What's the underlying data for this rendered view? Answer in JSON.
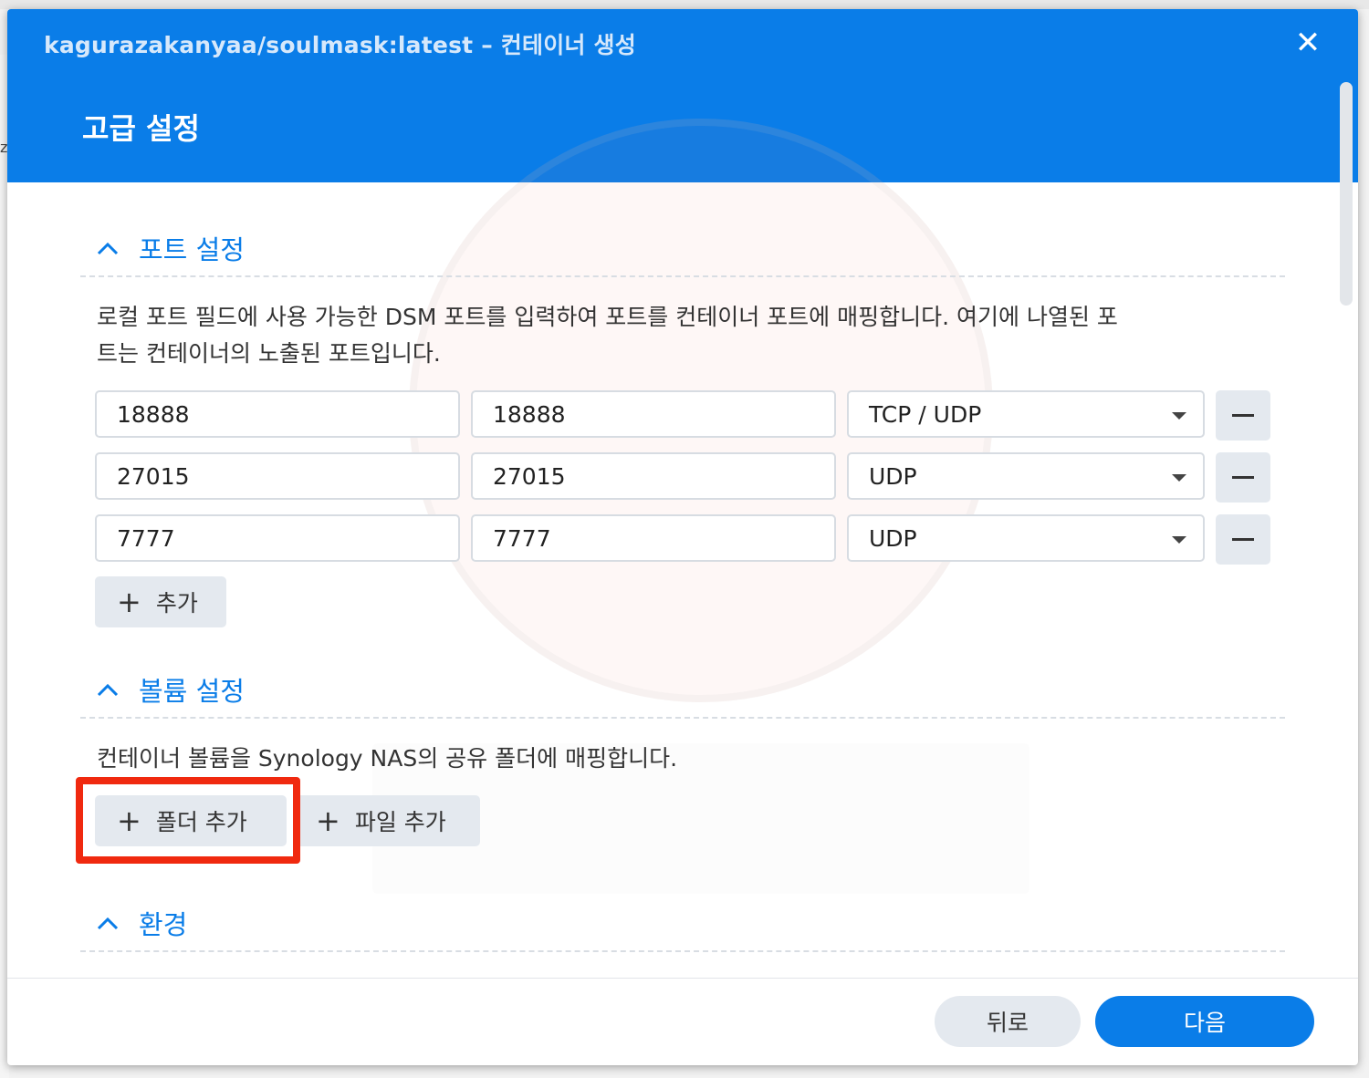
{
  "window": {
    "title": "kagurazakanyaa/soulmask:latest – 컨테이너 생성",
    "close_icon": "close-icon",
    "page_title": "고급 설정"
  },
  "background": {
    "left_char": "z"
  },
  "ports": {
    "header": "포트 설정",
    "description_line1": "로컬 포트 필드에 사용 가능한 DSM 포트를 입력하여 포트를 컨테이너 포트에 매핑합니다. 여기에 나열된 포",
    "description_line2": "트는 컨테이너의 노출된 포트입니다.",
    "rows": [
      {
        "local": "18888",
        "container": "18888",
        "protocol": "TCP / UDP"
      },
      {
        "local": "27015",
        "container": "27015",
        "protocol": "UDP"
      },
      {
        "local": "7777",
        "container": "7777",
        "protocol": "UDP"
      }
    ],
    "add_label": "추가"
  },
  "volumes": {
    "header": "볼륨 설정",
    "description": "컨테이너 볼륨을 Synology NAS의 공유 폴더에 매핑합니다.",
    "add_folder_label": "폴더 추가",
    "add_file_label": "파일 추가"
  },
  "environment": {
    "header": "환경"
  },
  "footer": {
    "back_label": "뒤로",
    "next_label": "다음"
  },
  "colors": {
    "accent": "#0a7de8",
    "highlight": "#f0290f"
  }
}
